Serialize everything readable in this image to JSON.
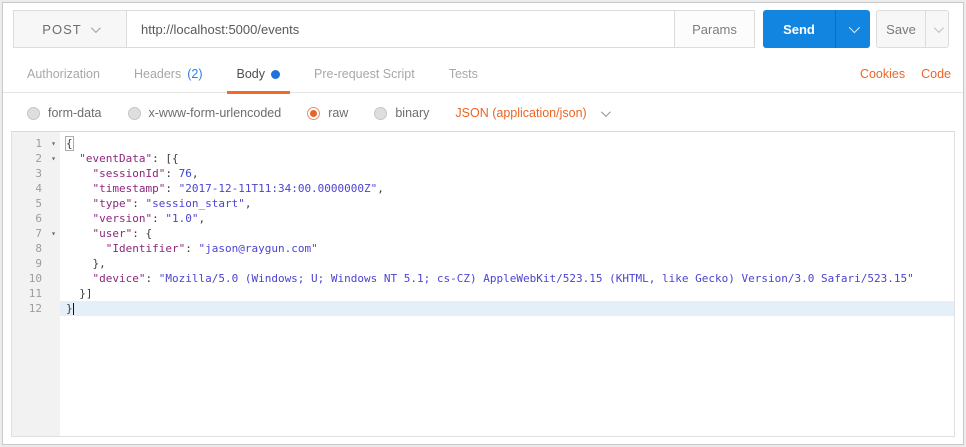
{
  "request_bar": {
    "method": "POST",
    "url": "http://localhost:5000/events",
    "params_label": "Params",
    "send_label": "Send",
    "save_label": "Save"
  },
  "tabs": {
    "authorization": "Authorization",
    "headers": "Headers",
    "headers_count": "(2)",
    "body": "Body",
    "prerequest": "Pre-request Script",
    "tests": "Tests",
    "cookies": "Cookies",
    "code": "Code"
  },
  "body_type_bar": {
    "options": [
      "form-data",
      "x-www-form-urlencoded",
      "raw",
      "binary"
    ],
    "selected": "raw",
    "content_type": "JSON (application/json)"
  },
  "colors": {
    "accent_orange": "#ec6526",
    "send_blue": "#1285e0",
    "tab_underline": "#f06b28",
    "link_blue": "#2e7fe0",
    "syntax_key": "#8e267e",
    "syntax_value": "#4b44d1",
    "active_line_bg": "#e4effa"
  },
  "editor": {
    "language": "JSON",
    "active_line": 12,
    "lines": [
      {
        "n": 1,
        "fold": true,
        "tokens": [
          [
            "pm",
            "{"
          ]
        ]
      },
      {
        "n": 2,
        "fold": true,
        "tokens": [
          [
            "p",
            "  "
          ],
          [
            "k",
            "\"eventData\""
          ],
          [
            "p",
            ": [{"
          ]
        ]
      },
      {
        "n": 3,
        "tokens": [
          [
            "p",
            "    "
          ],
          [
            "k",
            "\"sessionId\""
          ],
          [
            "p",
            ": "
          ],
          [
            "num",
            "76"
          ],
          [
            "p",
            ","
          ]
        ]
      },
      {
        "n": 4,
        "tokens": [
          [
            "p",
            "    "
          ],
          [
            "k",
            "\"timestamp\""
          ],
          [
            "p",
            ": "
          ],
          [
            "s",
            "\"2017-12-11T11:34:00.0000000Z\""
          ],
          [
            "p",
            ","
          ]
        ]
      },
      {
        "n": 5,
        "tokens": [
          [
            "p",
            "    "
          ],
          [
            "k",
            "\"type\""
          ],
          [
            "p",
            ": "
          ],
          [
            "s",
            "\"session_start\""
          ],
          [
            "p",
            ","
          ]
        ]
      },
      {
        "n": 6,
        "tokens": [
          [
            "p",
            "    "
          ],
          [
            "k",
            "\"version\""
          ],
          [
            "p",
            ": "
          ],
          [
            "s",
            "\"1.0\""
          ],
          [
            "p",
            ","
          ]
        ]
      },
      {
        "n": 7,
        "fold": true,
        "tokens": [
          [
            "p",
            "    "
          ],
          [
            "k",
            "\"user\""
          ],
          [
            "p",
            ": {"
          ]
        ]
      },
      {
        "n": 8,
        "tokens": [
          [
            "p",
            "      "
          ],
          [
            "k",
            "\"Identifier\""
          ],
          [
            "p",
            ": "
          ],
          [
            "s",
            "\"jason@raygun.com\""
          ]
        ]
      },
      {
        "n": 9,
        "tokens": [
          [
            "p",
            "    },"
          ]
        ]
      },
      {
        "n": 10,
        "tokens": [
          [
            "p",
            "    "
          ],
          [
            "k",
            "\"device\""
          ],
          [
            "p",
            ": "
          ],
          [
            "s",
            "\"Mozilla/5.0 (Windows; U; Windows NT 5.1; cs-CZ) AppleWebKit/523.15 (KHTML, like Gecko) Version/3.0 Safari/523.15\""
          ]
        ]
      },
      {
        "n": 11,
        "tokens": [
          [
            "p",
            "  }]"
          ]
        ]
      },
      {
        "n": 12,
        "active": true,
        "cursor": true,
        "tokens": [
          [
            "p",
            "}"
          ]
        ]
      }
    ]
  }
}
